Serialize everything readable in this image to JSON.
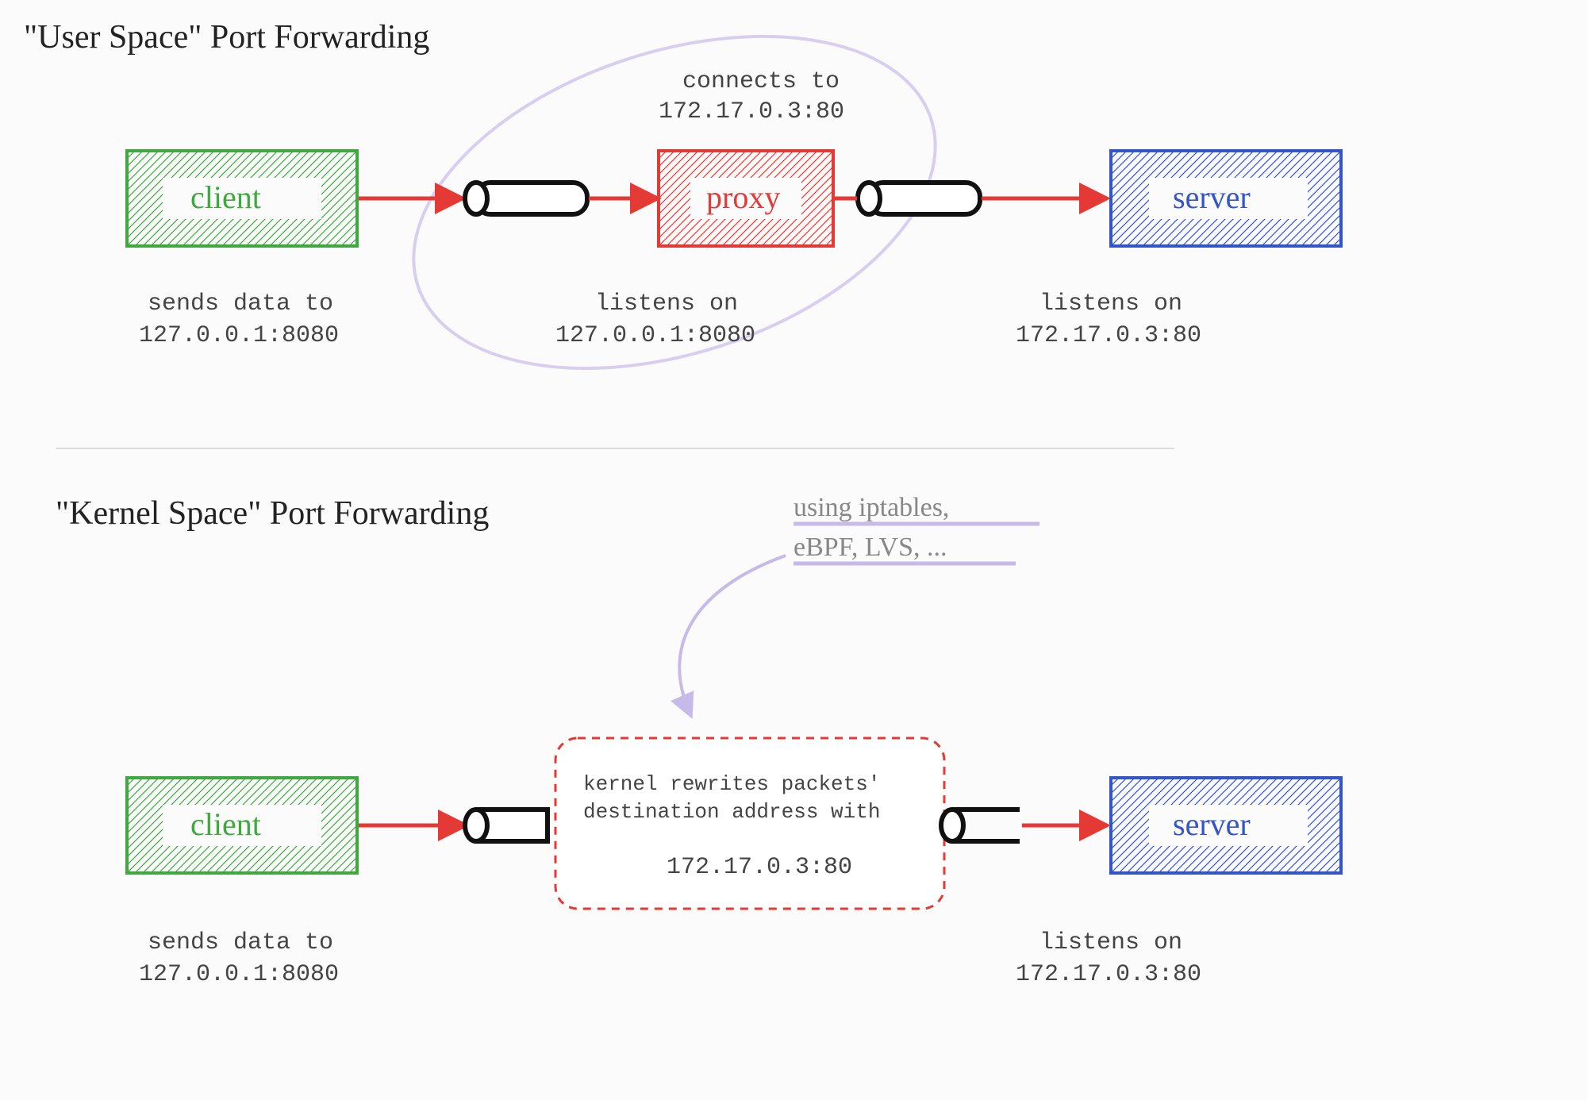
{
  "top": {
    "title": "\"User Space\" Port Forwarding",
    "client": {
      "label": "client",
      "desc1": "sends data to",
      "desc2": "127.0.0.1:8080"
    },
    "proxy": {
      "label": "proxy",
      "topdesc1": "connects to",
      "topdesc2": "172.17.0.3:80",
      "botdesc1": "listens on",
      "botdesc2": "127.0.0.1:8080"
    },
    "server": {
      "label": "server",
      "desc1": "listens on",
      "desc2": "172.17.0.3:80"
    }
  },
  "bottom": {
    "title": "\"Kernel Space\" Port Forwarding",
    "client": {
      "label": "client",
      "desc1": "sends data to",
      "desc2": "127.0.0.1:8080"
    },
    "kernel": {
      "line1": "kernel rewrites packets'",
      "line2": "destination address with",
      "line3": "172.17.0.3:80"
    },
    "note": {
      "line1": "using iptables,",
      "line2": "eBPF, LVS, ..."
    },
    "server": {
      "label": "server",
      "desc1": "listens on",
      "desc2": "172.17.0.3:80"
    }
  },
  "colors": {
    "green": "#3fa83e",
    "red": "#e53935",
    "blue": "#3355cc",
    "lav": "#c6bbe8",
    "grey": "#999"
  }
}
